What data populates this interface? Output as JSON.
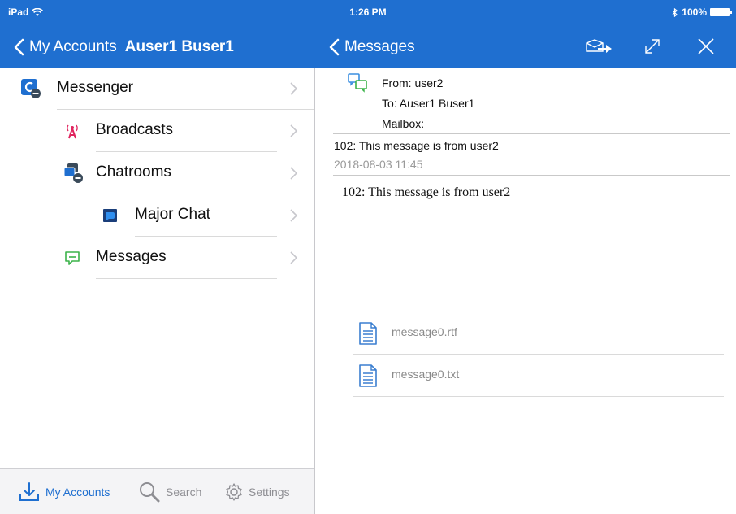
{
  "status_bar": {
    "device": "iPad",
    "time": "1:26 PM",
    "battery": "100%"
  },
  "left_nav": {
    "back_label": "My Accounts",
    "title": "Auser1 Buser1"
  },
  "right_nav": {
    "back_label": "Messages",
    "icons": [
      "forward-icon",
      "expand-icon",
      "close-icon"
    ]
  },
  "sidebar": {
    "items": [
      {
        "label": "Messenger",
        "icon": "messenger-icon"
      },
      {
        "label": "Broadcasts",
        "icon": "broadcast-icon"
      },
      {
        "label": "Chatrooms",
        "icon": "chatrooms-icon"
      },
      {
        "label": "Major Chat",
        "icon": "chat-room-icon"
      },
      {
        "label": "Messages",
        "icon": "message-icon"
      }
    ]
  },
  "tabbar": {
    "tabs": [
      {
        "label": "My Accounts",
        "icon": "download-icon",
        "active": true
      },
      {
        "label": "Search",
        "icon": "search-icon",
        "active": false
      },
      {
        "label": "Settings",
        "icon": "gear-icon",
        "active": false
      }
    ]
  },
  "message": {
    "from_line": "From:  user2",
    "to_line": "To:  Auser1 Buser1",
    "mailbox_line": "Mailbox:",
    "subject": "102: This message is from user2",
    "date": "2018-08-03 11:45",
    "body": "102: This message is from user2",
    "attachments": [
      {
        "name": "message0.rtf"
      },
      {
        "name": "message0.txt"
      }
    ]
  },
  "colors": {
    "accent": "#1f6fd0",
    "broadcast": "#e0245e",
    "message_green": "#3cb34a"
  }
}
